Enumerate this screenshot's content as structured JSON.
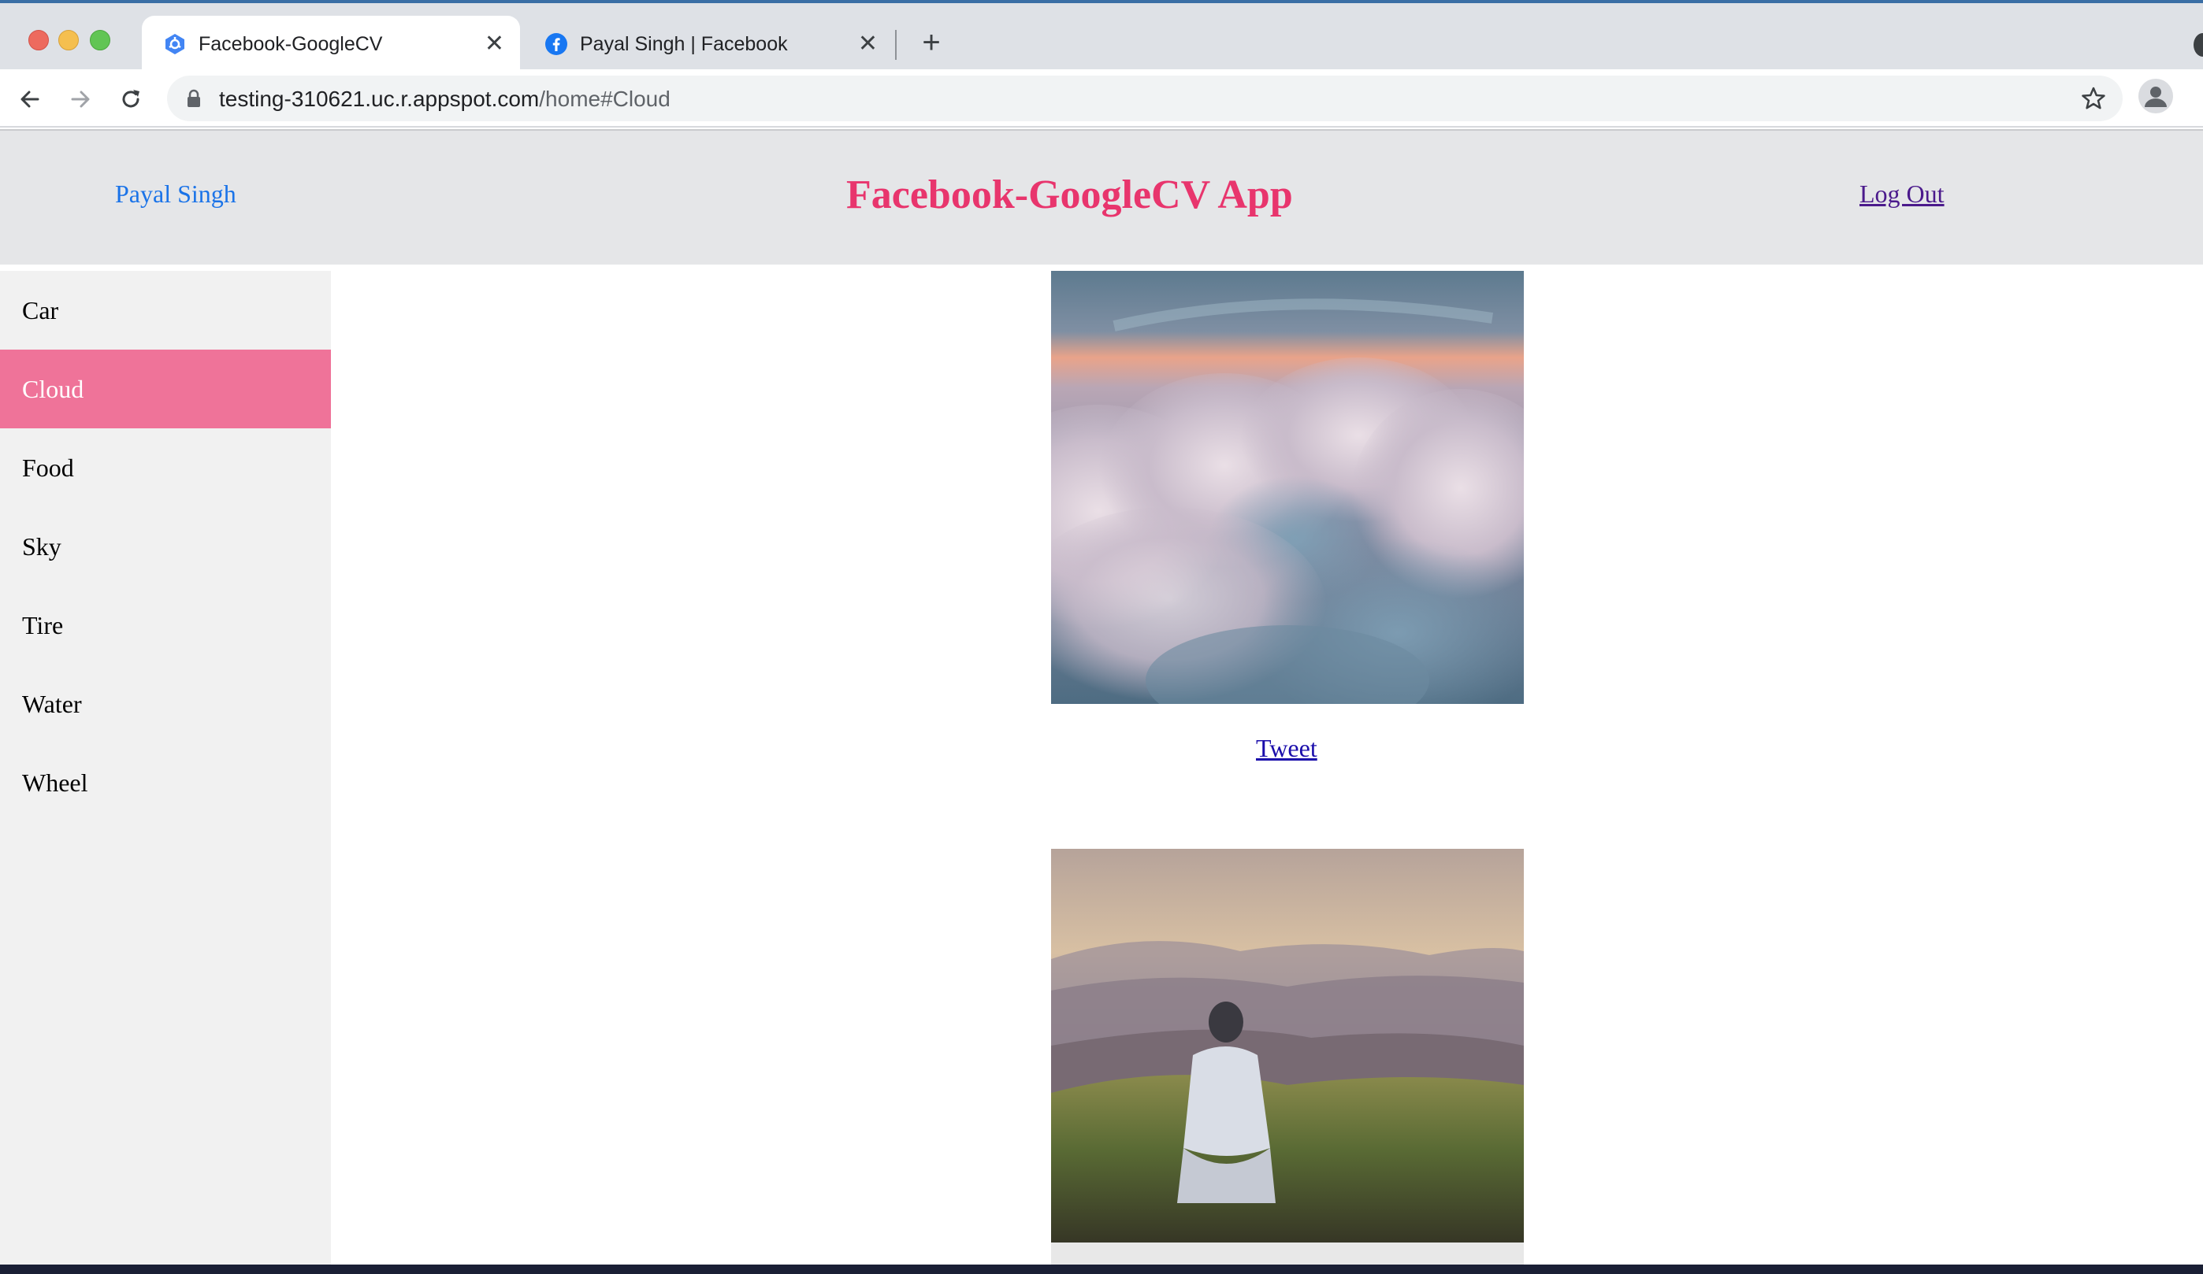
{
  "browser": {
    "tabs": [
      {
        "title": "Facebook-GoogleCV",
        "active": true
      },
      {
        "title": "Payal Singh | Facebook",
        "active": false
      }
    ],
    "url_host": "testing-310621.uc.r.appspot.com",
    "url_path": "/home#Cloud"
  },
  "header": {
    "user_name": "Payal Singh",
    "title": "Facebook-GoogleCV App",
    "logout_label": "Log Out"
  },
  "sidebar": {
    "items": [
      {
        "label": "Car"
      },
      {
        "label": "Cloud"
      },
      {
        "label": "Food"
      },
      {
        "label": "Sky"
      },
      {
        "label": "Tire"
      },
      {
        "label": "Water"
      },
      {
        "label": "Wheel"
      }
    ],
    "active_item": "Cloud"
  },
  "main": {
    "tweet_label": "Tweet"
  },
  "colors": {
    "title": "#e8356d",
    "active_item_bg": "#ef7399",
    "user_link": "#1a73e8",
    "header_bg": "#e5e6e8"
  }
}
